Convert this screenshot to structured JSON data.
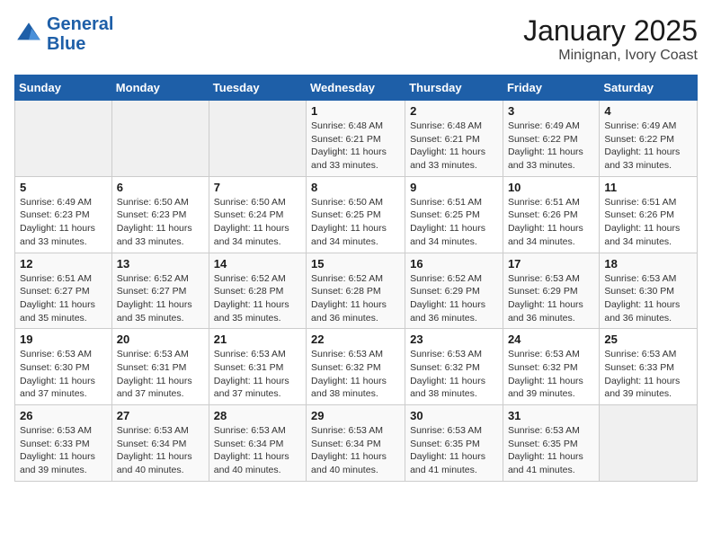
{
  "header": {
    "logo_line1": "General",
    "logo_line2": "Blue",
    "month_year": "January 2025",
    "location": "Minignan, Ivory Coast"
  },
  "days_of_week": [
    "Sunday",
    "Monday",
    "Tuesday",
    "Wednesday",
    "Thursday",
    "Friday",
    "Saturday"
  ],
  "weeks": [
    [
      {
        "day": "",
        "info": ""
      },
      {
        "day": "",
        "info": ""
      },
      {
        "day": "",
        "info": ""
      },
      {
        "day": "1",
        "info": "Sunrise: 6:48 AM\nSunset: 6:21 PM\nDaylight: 11 hours\nand 33 minutes."
      },
      {
        "day": "2",
        "info": "Sunrise: 6:48 AM\nSunset: 6:21 PM\nDaylight: 11 hours\nand 33 minutes."
      },
      {
        "day": "3",
        "info": "Sunrise: 6:49 AM\nSunset: 6:22 PM\nDaylight: 11 hours\nand 33 minutes."
      },
      {
        "day": "4",
        "info": "Sunrise: 6:49 AM\nSunset: 6:22 PM\nDaylight: 11 hours\nand 33 minutes."
      }
    ],
    [
      {
        "day": "5",
        "info": "Sunrise: 6:49 AM\nSunset: 6:23 PM\nDaylight: 11 hours\nand 33 minutes."
      },
      {
        "day": "6",
        "info": "Sunrise: 6:50 AM\nSunset: 6:23 PM\nDaylight: 11 hours\nand 33 minutes."
      },
      {
        "day": "7",
        "info": "Sunrise: 6:50 AM\nSunset: 6:24 PM\nDaylight: 11 hours\nand 34 minutes."
      },
      {
        "day": "8",
        "info": "Sunrise: 6:50 AM\nSunset: 6:25 PM\nDaylight: 11 hours\nand 34 minutes."
      },
      {
        "day": "9",
        "info": "Sunrise: 6:51 AM\nSunset: 6:25 PM\nDaylight: 11 hours\nand 34 minutes."
      },
      {
        "day": "10",
        "info": "Sunrise: 6:51 AM\nSunset: 6:26 PM\nDaylight: 11 hours\nand 34 minutes."
      },
      {
        "day": "11",
        "info": "Sunrise: 6:51 AM\nSunset: 6:26 PM\nDaylight: 11 hours\nand 34 minutes."
      }
    ],
    [
      {
        "day": "12",
        "info": "Sunrise: 6:51 AM\nSunset: 6:27 PM\nDaylight: 11 hours\nand 35 minutes."
      },
      {
        "day": "13",
        "info": "Sunrise: 6:52 AM\nSunset: 6:27 PM\nDaylight: 11 hours\nand 35 minutes."
      },
      {
        "day": "14",
        "info": "Sunrise: 6:52 AM\nSunset: 6:28 PM\nDaylight: 11 hours\nand 35 minutes."
      },
      {
        "day": "15",
        "info": "Sunrise: 6:52 AM\nSunset: 6:28 PM\nDaylight: 11 hours\nand 36 minutes."
      },
      {
        "day": "16",
        "info": "Sunrise: 6:52 AM\nSunset: 6:29 PM\nDaylight: 11 hours\nand 36 minutes."
      },
      {
        "day": "17",
        "info": "Sunrise: 6:53 AM\nSunset: 6:29 PM\nDaylight: 11 hours\nand 36 minutes."
      },
      {
        "day": "18",
        "info": "Sunrise: 6:53 AM\nSunset: 6:30 PM\nDaylight: 11 hours\nand 36 minutes."
      }
    ],
    [
      {
        "day": "19",
        "info": "Sunrise: 6:53 AM\nSunset: 6:30 PM\nDaylight: 11 hours\nand 37 minutes."
      },
      {
        "day": "20",
        "info": "Sunrise: 6:53 AM\nSunset: 6:31 PM\nDaylight: 11 hours\nand 37 minutes."
      },
      {
        "day": "21",
        "info": "Sunrise: 6:53 AM\nSunset: 6:31 PM\nDaylight: 11 hours\nand 37 minutes."
      },
      {
        "day": "22",
        "info": "Sunrise: 6:53 AM\nSunset: 6:32 PM\nDaylight: 11 hours\nand 38 minutes."
      },
      {
        "day": "23",
        "info": "Sunrise: 6:53 AM\nSunset: 6:32 PM\nDaylight: 11 hours\nand 38 minutes."
      },
      {
        "day": "24",
        "info": "Sunrise: 6:53 AM\nSunset: 6:32 PM\nDaylight: 11 hours\nand 39 minutes."
      },
      {
        "day": "25",
        "info": "Sunrise: 6:53 AM\nSunset: 6:33 PM\nDaylight: 11 hours\nand 39 minutes."
      }
    ],
    [
      {
        "day": "26",
        "info": "Sunrise: 6:53 AM\nSunset: 6:33 PM\nDaylight: 11 hours\nand 39 minutes."
      },
      {
        "day": "27",
        "info": "Sunrise: 6:53 AM\nSunset: 6:34 PM\nDaylight: 11 hours\nand 40 minutes."
      },
      {
        "day": "28",
        "info": "Sunrise: 6:53 AM\nSunset: 6:34 PM\nDaylight: 11 hours\nand 40 minutes."
      },
      {
        "day": "29",
        "info": "Sunrise: 6:53 AM\nSunset: 6:34 PM\nDaylight: 11 hours\nand 40 minutes."
      },
      {
        "day": "30",
        "info": "Sunrise: 6:53 AM\nSunset: 6:35 PM\nDaylight: 11 hours\nand 41 minutes."
      },
      {
        "day": "31",
        "info": "Sunrise: 6:53 AM\nSunset: 6:35 PM\nDaylight: 11 hours\nand 41 minutes."
      },
      {
        "day": "",
        "info": ""
      }
    ]
  ]
}
